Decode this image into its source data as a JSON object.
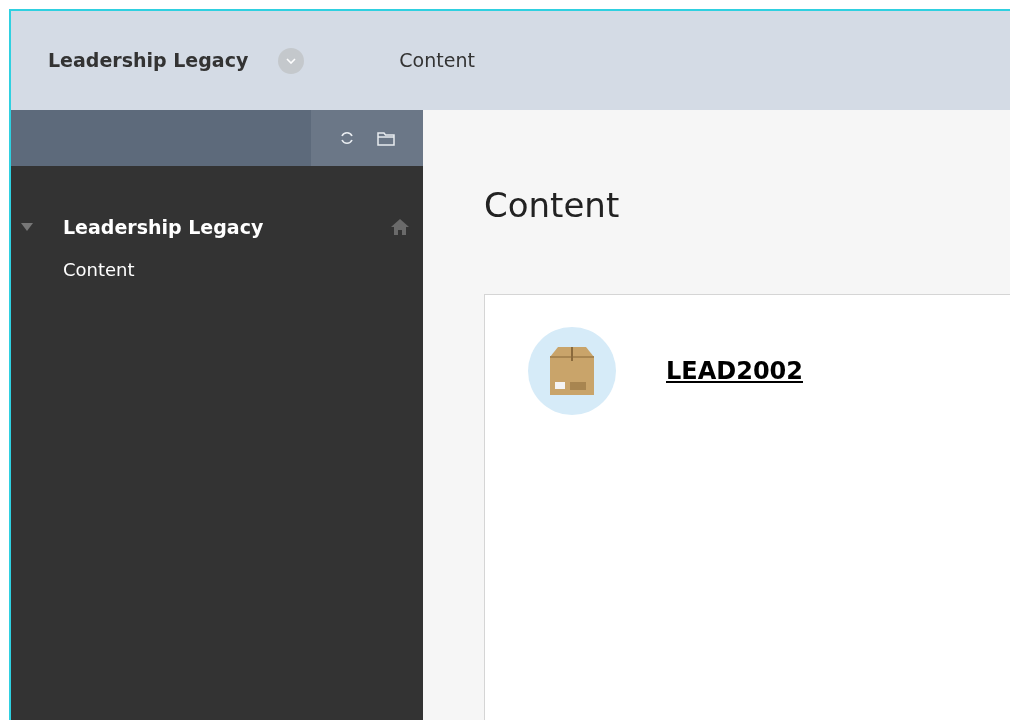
{
  "header": {
    "course_title": "Leadership Legacy",
    "breadcrumb": "Content"
  },
  "sidebar": {
    "items": [
      {
        "label": "Leadership Legacy",
        "kind": "course",
        "expanded": true,
        "children": [
          {
            "label": "Content"
          }
        ]
      }
    ]
  },
  "main": {
    "title": "Content",
    "items": [
      {
        "title": "LEAD2002"
      }
    ]
  }
}
